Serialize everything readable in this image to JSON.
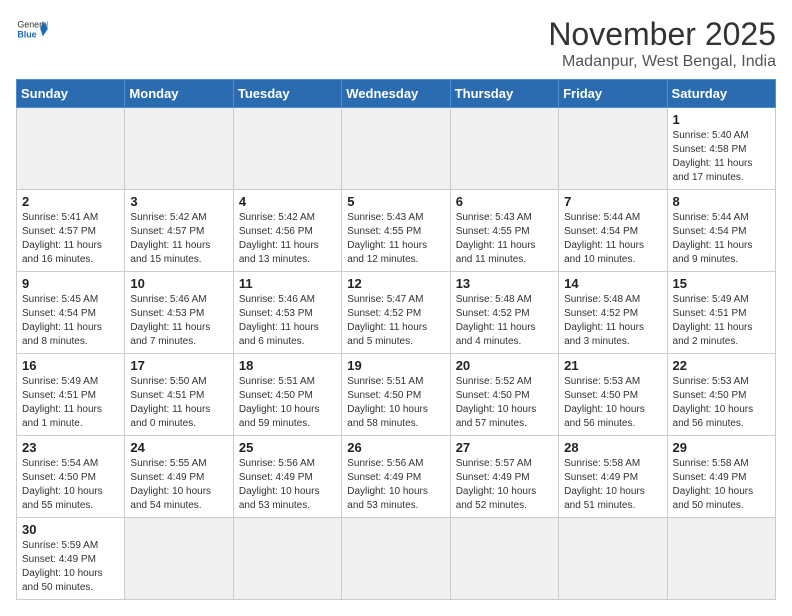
{
  "header": {
    "logo_general": "General",
    "logo_blue": "Blue",
    "month": "November 2025",
    "location": "Madanpur, West Bengal, India"
  },
  "weekdays": [
    "Sunday",
    "Monday",
    "Tuesday",
    "Wednesday",
    "Thursday",
    "Friday",
    "Saturday"
  ],
  "days": [
    {
      "date": null,
      "info": ""
    },
    {
      "date": null,
      "info": ""
    },
    {
      "date": null,
      "info": ""
    },
    {
      "date": null,
      "info": ""
    },
    {
      "date": null,
      "info": ""
    },
    {
      "date": null,
      "info": ""
    },
    {
      "date": "1",
      "info": "Sunrise: 5:40 AM\nSunset: 4:58 PM\nDaylight: 11 hours and 17 minutes."
    },
    {
      "date": "2",
      "info": "Sunrise: 5:41 AM\nSunset: 4:57 PM\nDaylight: 11 hours and 16 minutes."
    },
    {
      "date": "3",
      "info": "Sunrise: 5:42 AM\nSunset: 4:57 PM\nDaylight: 11 hours and 15 minutes."
    },
    {
      "date": "4",
      "info": "Sunrise: 5:42 AM\nSunset: 4:56 PM\nDaylight: 11 hours and 13 minutes."
    },
    {
      "date": "5",
      "info": "Sunrise: 5:43 AM\nSunset: 4:55 PM\nDaylight: 11 hours and 12 minutes."
    },
    {
      "date": "6",
      "info": "Sunrise: 5:43 AM\nSunset: 4:55 PM\nDaylight: 11 hours and 11 minutes."
    },
    {
      "date": "7",
      "info": "Sunrise: 5:44 AM\nSunset: 4:54 PM\nDaylight: 11 hours and 10 minutes."
    },
    {
      "date": "8",
      "info": "Sunrise: 5:44 AM\nSunset: 4:54 PM\nDaylight: 11 hours and 9 minutes."
    },
    {
      "date": "9",
      "info": "Sunrise: 5:45 AM\nSunset: 4:54 PM\nDaylight: 11 hours and 8 minutes."
    },
    {
      "date": "10",
      "info": "Sunrise: 5:46 AM\nSunset: 4:53 PM\nDaylight: 11 hours and 7 minutes."
    },
    {
      "date": "11",
      "info": "Sunrise: 5:46 AM\nSunset: 4:53 PM\nDaylight: 11 hours and 6 minutes."
    },
    {
      "date": "12",
      "info": "Sunrise: 5:47 AM\nSunset: 4:52 PM\nDaylight: 11 hours and 5 minutes."
    },
    {
      "date": "13",
      "info": "Sunrise: 5:48 AM\nSunset: 4:52 PM\nDaylight: 11 hours and 4 minutes."
    },
    {
      "date": "14",
      "info": "Sunrise: 5:48 AM\nSunset: 4:52 PM\nDaylight: 11 hours and 3 minutes."
    },
    {
      "date": "15",
      "info": "Sunrise: 5:49 AM\nSunset: 4:51 PM\nDaylight: 11 hours and 2 minutes."
    },
    {
      "date": "16",
      "info": "Sunrise: 5:49 AM\nSunset: 4:51 PM\nDaylight: 11 hours and 1 minute."
    },
    {
      "date": "17",
      "info": "Sunrise: 5:50 AM\nSunset: 4:51 PM\nDaylight: 11 hours and 0 minutes."
    },
    {
      "date": "18",
      "info": "Sunrise: 5:51 AM\nSunset: 4:50 PM\nDaylight: 10 hours and 59 minutes."
    },
    {
      "date": "19",
      "info": "Sunrise: 5:51 AM\nSunset: 4:50 PM\nDaylight: 10 hours and 58 minutes."
    },
    {
      "date": "20",
      "info": "Sunrise: 5:52 AM\nSunset: 4:50 PM\nDaylight: 10 hours and 57 minutes."
    },
    {
      "date": "21",
      "info": "Sunrise: 5:53 AM\nSunset: 4:50 PM\nDaylight: 10 hours and 56 minutes."
    },
    {
      "date": "22",
      "info": "Sunrise: 5:53 AM\nSunset: 4:50 PM\nDaylight: 10 hours and 56 minutes."
    },
    {
      "date": "23",
      "info": "Sunrise: 5:54 AM\nSunset: 4:50 PM\nDaylight: 10 hours and 55 minutes."
    },
    {
      "date": "24",
      "info": "Sunrise: 5:55 AM\nSunset: 4:49 PM\nDaylight: 10 hours and 54 minutes."
    },
    {
      "date": "25",
      "info": "Sunrise: 5:56 AM\nSunset: 4:49 PM\nDaylight: 10 hours and 53 minutes."
    },
    {
      "date": "26",
      "info": "Sunrise: 5:56 AM\nSunset: 4:49 PM\nDaylight: 10 hours and 53 minutes."
    },
    {
      "date": "27",
      "info": "Sunrise: 5:57 AM\nSunset: 4:49 PM\nDaylight: 10 hours and 52 minutes."
    },
    {
      "date": "28",
      "info": "Sunrise: 5:58 AM\nSunset: 4:49 PM\nDaylight: 10 hours and 51 minutes."
    },
    {
      "date": "29",
      "info": "Sunrise: 5:58 AM\nSunset: 4:49 PM\nDaylight: 10 hours and 50 minutes."
    },
    {
      "date": "30",
      "info": "Sunrise: 5:59 AM\nSunset: 4:49 PM\nDaylight: 10 hours and 50 minutes."
    },
    {
      "date": null,
      "info": ""
    },
    {
      "date": null,
      "info": ""
    },
    {
      "date": null,
      "info": ""
    },
    {
      "date": null,
      "info": ""
    },
    {
      "date": null,
      "info": ""
    },
    {
      "date": null,
      "info": ""
    }
  ]
}
